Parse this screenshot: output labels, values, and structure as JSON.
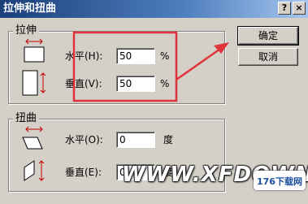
{
  "window": {
    "title": "拉伸和扭曲",
    "help_label": "?",
    "close_label": "×"
  },
  "stretch": {
    "legend": "拉伸",
    "horizontal_label": "水平(H):",
    "horizontal_value": "50",
    "horizontal_unit": "%",
    "vertical_label": "垂直(V):",
    "vertical_value": "50",
    "vertical_unit": "%"
  },
  "skew": {
    "legend": "扭曲",
    "horizontal_label": "水平(O):",
    "horizontal_value": "0",
    "horizontal_unit": "度",
    "vertical_label": "垂直(E):",
    "vertical_value": "0",
    "vertical_unit": "度"
  },
  "buttons": {
    "ok_label": "确定",
    "cancel_label": "取消"
  },
  "annotation": {
    "highlight_color": "#e0343c"
  },
  "watermark": {
    "text": "WWW.XFDOWN",
    "logo_text": "176下载网"
  }
}
